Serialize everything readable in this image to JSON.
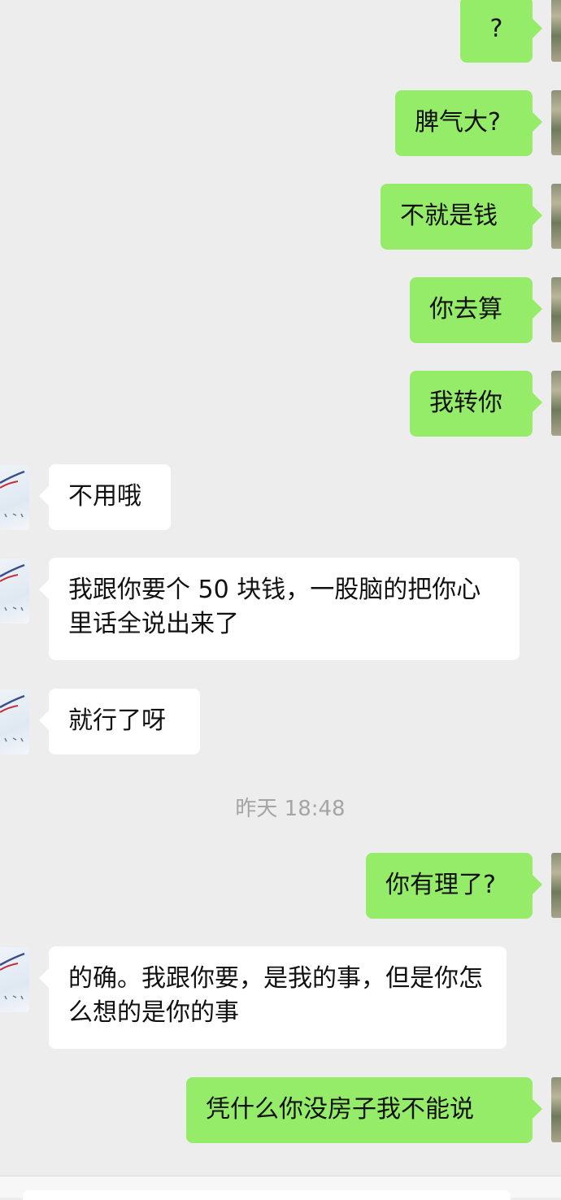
{
  "chat": {
    "messages": [
      {
        "from": "me",
        "text": "?"
      },
      {
        "from": "me",
        "text": "脾气大?"
      },
      {
        "from": "me",
        "text": "不就是钱"
      },
      {
        "from": "me",
        "text": "你去算"
      },
      {
        "from": "me",
        "text": "我转你"
      },
      {
        "from": "them",
        "text": "不用哦"
      },
      {
        "from": "them",
        "text": "我跟你要个 50 块钱，一股脑的把你心里话全说出来了"
      },
      {
        "from": "them",
        "text": "就行了呀"
      },
      {
        "from": "me",
        "text": "你有理了?"
      },
      {
        "from": "them",
        "text": "的确。我跟你要，是我的事，但是你怎么想的是你的事"
      },
      {
        "from": "me",
        "text": "凭什么你没房子我不能说"
      }
    ],
    "timestamp": "昨天 18:48"
  },
  "colors": {
    "background": "#ededed",
    "my_bubble": "#95ec69",
    "their_bubble": "#ffffff",
    "timestamp_text": "#a5a5a5"
  }
}
